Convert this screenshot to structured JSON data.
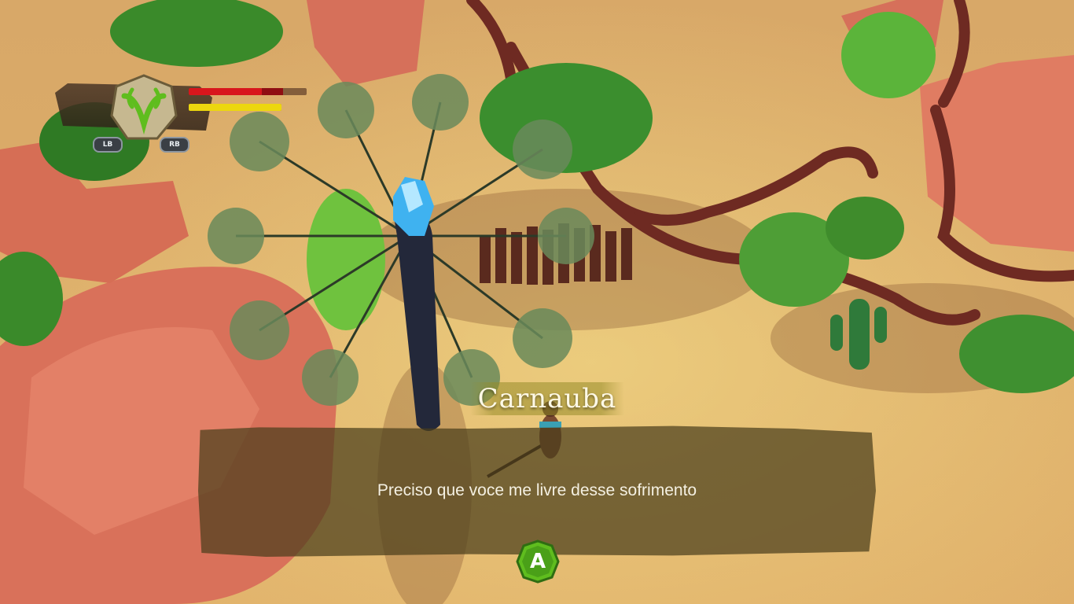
{
  "hud": {
    "health": 0.62,
    "stamina": 1.0,
    "lb_label": "LB",
    "rb_label": "RB",
    "emblem_icon": "green-leaf-emblem-icon"
  },
  "dialogue": {
    "speaker": "Carnauba",
    "text": "Preciso que voce me livre desse sofrimento",
    "confirm_button": "A"
  },
  "colors": {
    "health": "#d8161c",
    "stamina": "#ecd70e",
    "confirm": "#5fbd1e",
    "sand": "#d9a45a"
  }
}
